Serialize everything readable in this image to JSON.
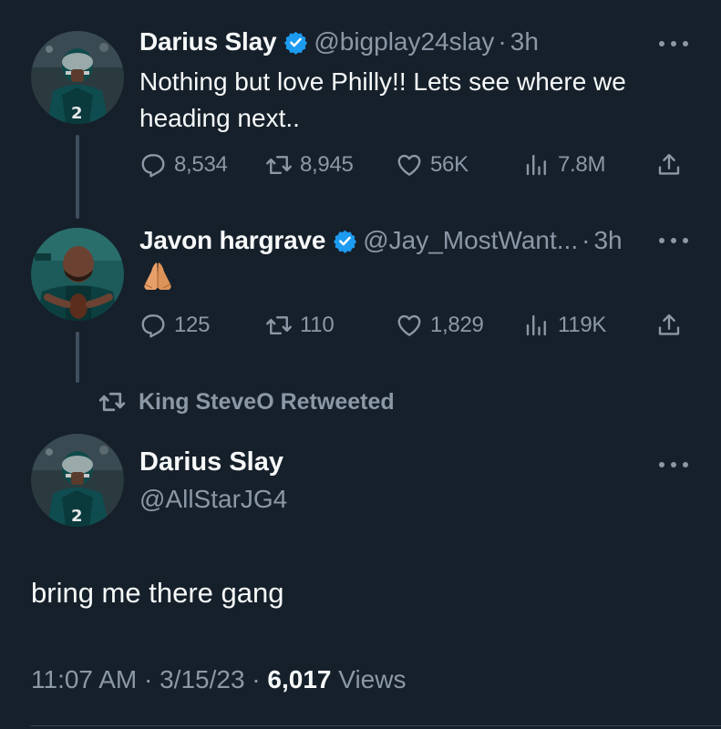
{
  "colors": {
    "background": "#15202b",
    "text_primary": "#f7f9f9",
    "text_secondary": "#8b98a5",
    "verified_badge": "#1d9bf0",
    "thread_line": "#3f4f5f"
  },
  "thread": [
    {
      "author_name": "Darius Slay",
      "verified": true,
      "handle": "@bigplay24slay",
      "separator": "·",
      "time": "3h",
      "text": "Nothing but love Philly!! Lets see where we heading next..",
      "avatar_icon": "eagles-player-avatar",
      "stats": {
        "replies": "8,534",
        "retweets": "8,945",
        "likes": "56K",
        "views": "7.8M"
      }
    },
    {
      "author_name": "Javon hargrave",
      "verified": true,
      "handle": "@Jay_MostWant...",
      "separator": "·",
      "time": "3h",
      "text_icon": "folded-hands-emoji",
      "avatar_icon": "eagles-player-avatar",
      "stats": {
        "replies": "125",
        "retweets": "110",
        "likes": "1,829",
        "views": "119K"
      }
    }
  ],
  "retweet_context": "King SteveO Retweeted",
  "main_tweet": {
    "author_name": "Darius Slay",
    "handle": "@AllStarJG4",
    "avatar_icon": "eagles-player-avatar",
    "text": "bring me there gang",
    "timestamp": "11:07 AM · 3/15/23 · ",
    "views_count": "6,017",
    "views_label": " Views"
  }
}
